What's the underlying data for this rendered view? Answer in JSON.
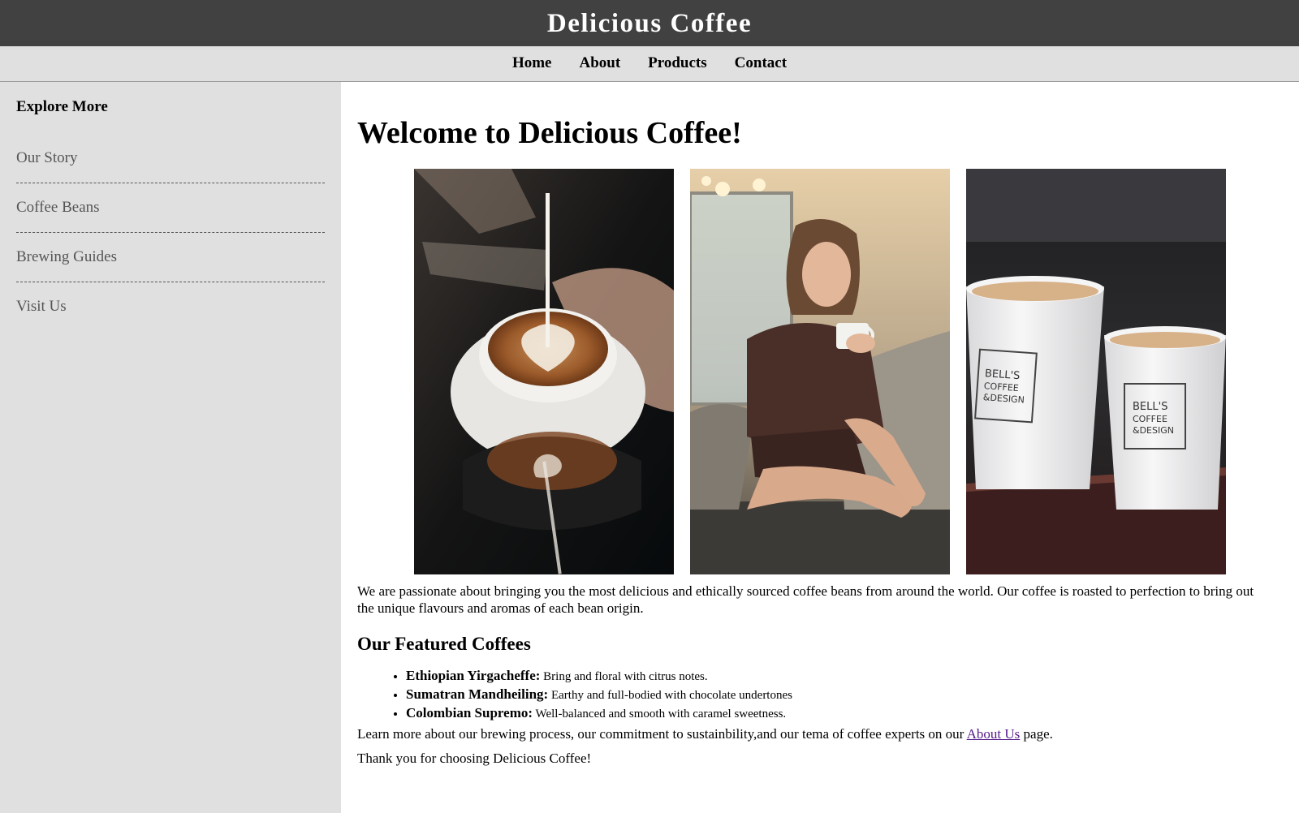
{
  "header": {
    "title": "Delicious Coffee"
  },
  "nav": {
    "items": [
      {
        "label": "Home"
      },
      {
        "label": "About"
      },
      {
        "label": "Products"
      },
      {
        "label": "Contact"
      }
    ]
  },
  "sidebar": {
    "heading": "Explore More",
    "items": [
      {
        "label": "Our Story"
      },
      {
        "label": "Coffee Beans"
      },
      {
        "label": "Brewing Guides"
      },
      {
        "label": "Visit Us"
      }
    ]
  },
  "main": {
    "title": "Welcome to Delicious Coffee!",
    "images": [
      {
        "icon": "latte-art-photo"
      },
      {
        "icon": "woman-with-coffee-photo"
      },
      {
        "icon": "paper-cups-photo",
        "cup_print": [
          "BELL'S",
          "COFFEE",
          "&DESIGN"
        ]
      }
    ],
    "intro": "We are passionate about bringing you the most delicious and ethically sourced coffee beans from around the world. Our coffee is roasted to perfection to bring out the unique flavours and aromas of each bean origin.",
    "featured_heading": "Our Featured Coffees",
    "featured": [
      {
        "name": "Ethiopian Yirgacheffe:",
        "desc": " Bring and floral with citrus notes."
      },
      {
        "name": "Sumatran Mandheiling:",
        "desc": " Earthy and full-bodied with chocolate undertones"
      },
      {
        "name": "Colombian Supremo:",
        "desc": " Well-balanced and smooth with caramel sweetness."
      }
    ],
    "learn_more_before": "Learn more about our brewing process, our commitment to sustainbility,and our tema of coffee experts on our ",
    "learn_more_link": "About Us",
    "learn_more_after": " page.",
    "thanks": "Thank you for choosing Delicious Coffee!"
  },
  "colors": {
    "header_bg": "#424142",
    "nav_bg": "#e0e0e0",
    "sidebar_bg": "#e0e0e0",
    "sidebar_link": "#555555",
    "visited_link": "#551a8b"
  }
}
